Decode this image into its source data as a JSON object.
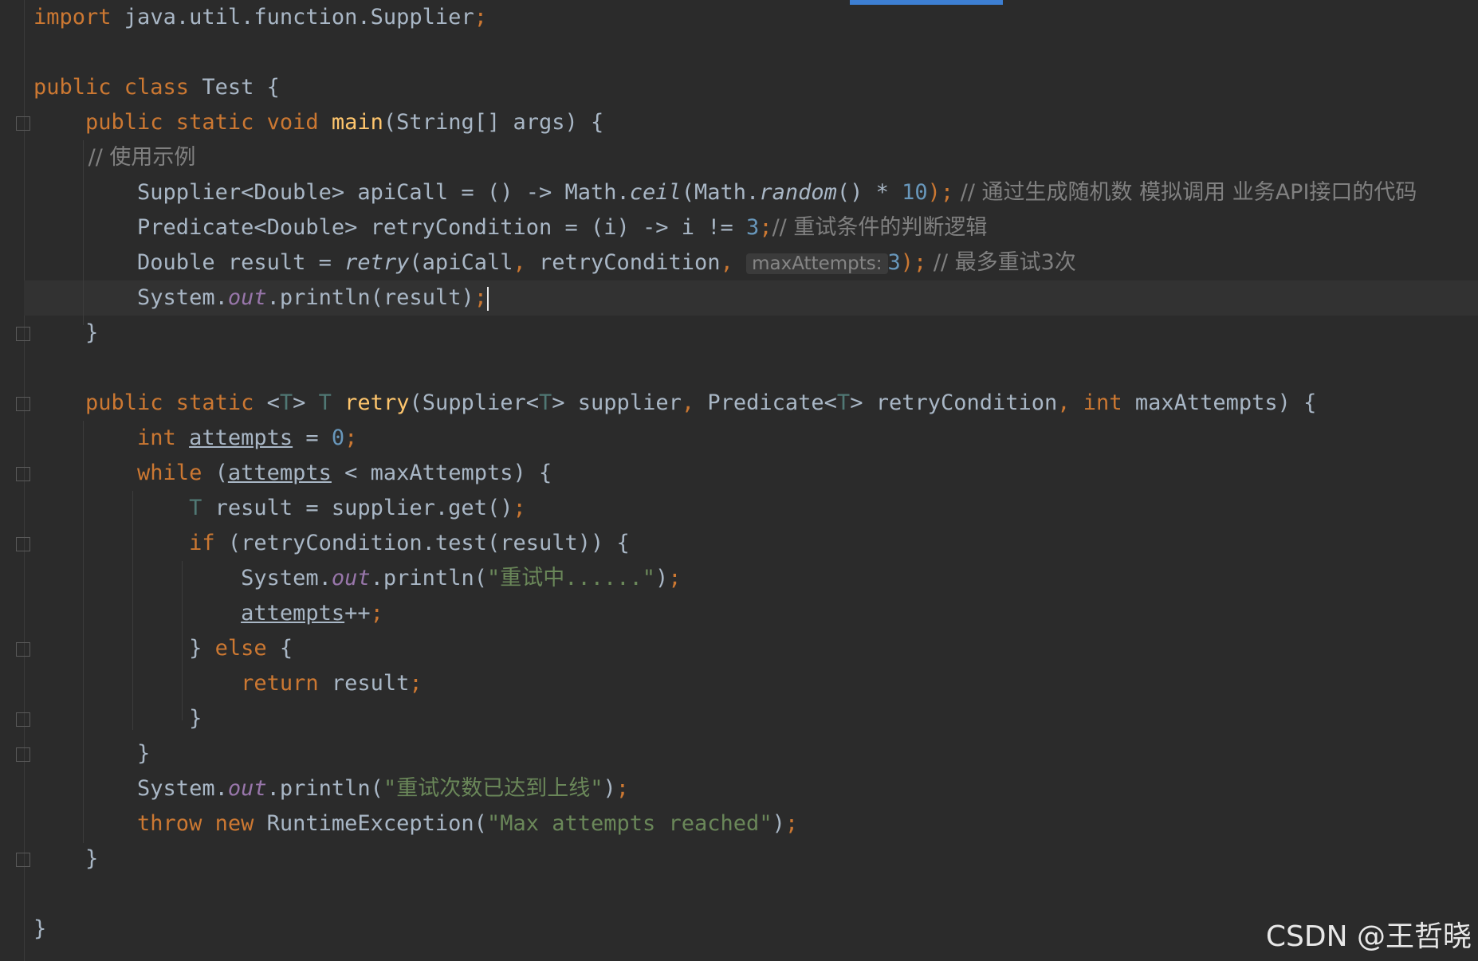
{
  "editor": {
    "line_01_a": "import",
    "line_01_b": " java.util.function.Supplier",
    "line_01_c": ";",
    "line_02_a": "public class",
    "line_02_b": " Test {",
    "line_03_a": "    public static void",
    "line_03_b": "main",
    "line_03_c": "(String[] args) {",
    "line_04_a": "        // 使用示例",
    "line_05_a": "        Supplier<Double> apiCall = () -> Math.",
    "line_05_b": "ceil",
    "line_05_c": "(Math.",
    "line_05_d": "random",
    "line_05_e": "() * ",
    "line_05_f": "10",
    "line_05_g": ");",
    "line_05_h": " // 通过生成随机数 模拟调用 业务API接口的代码",
    "line_06_a": "        Predicate<Double> retryCondition = (i) -> i != ",
    "line_06_b": "3",
    "line_06_c": ";",
    "line_06_d": "// 重试条件的判断逻辑",
    "line_07_a": "        Double result = ",
    "line_07_b": "retry",
    "line_07_c": "(apiCall",
    "line_07_d": ",",
    "line_07_e": " retryCondition",
    "line_07_f": ",",
    "line_07_hint": "maxAttempts:",
    "line_07_g": "3",
    "line_07_h": ");",
    "line_07_i": " // 最多重试3次",
    "line_08_a": "        System.",
    "line_08_b": "out",
    "line_08_c": ".println(result)",
    "line_08_d": ";",
    "line_09_a": "    }",
    "line_10_a": "    public static",
    "line_10_b": " <",
    "line_10_c": "T",
    "line_10_d": "> ",
    "line_10_e": "T",
    "line_10_f": "retry",
    "line_10_g": "(Supplier<",
    "line_10_h": "T",
    "line_10_i": "> supplier",
    "line_10_j": ",",
    "line_10_k": " Predicate<",
    "line_10_l": "T",
    "line_10_m": "> retryCondition",
    "line_10_n": ",",
    "line_10_o": " int",
    "line_10_p": " maxAttempts) {",
    "line_11_a": "        int",
    "line_11_b": "attempts",
    "line_11_c": " = ",
    "line_11_d": "0",
    "line_11_e": ";",
    "line_12_a": "        while",
    "line_12_b": " (",
    "line_12_c": "attempts",
    "line_12_d": " < maxAttempts) {",
    "line_13_a": "            T",
    "line_13_b": " result = supplier.get()",
    "line_13_c": ";",
    "line_14_a": "            if",
    "line_14_b": " (retryCondition.test(result)) {",
    "line_15_a": "                System.",
    "line_15_b": "out",
    "line_15_c": ".println(",
    "line_15_d": "\"重试中......\"",
    "line_15_e": ")",
    "line_15_f": ";",
    "line_16_a": "attempts",
    "line_16_b": "++",
    "line_16_c": ";",
    "line_17_a": "            } ",
    "line_17_b": "else",
    "line_17_c": " {",
    "line_18_a": "                return",
    "line_18_b": " result",
    "line_18_c": ";",
    "line_19_a": "            }",
    "line_20_a": "        }",
    "line_21_a": "        System.",
    "line_21_b": "out",
    "line_21_c": ".println(",
    "line_21_d": "\"重试次数已达到上线\"",
    "line_21_e": ")",
    "line_21_f": ";",
    "line_22_a": "        throw new",
    "line_22_b": " RuntimeException(",
    "line_22_c": "\"Max attempts reached\"",
    "line_22_d": ")",
    "line_22_e": ";",
    "line_23_a": "    }",
    "line_24_a": "}"
  },
  "watermark": "CSDN @王哲晓",
  "colors": {
    "background": "#2b2b2b",
    "keyword": "#cc7832",
    "function": "#ffc66d",
    "number": "#6897bb",
    "string": "#6a8759",
    "comment": "#808080",
    "field": "#9876aa",
    "text": "#a9b7c6",
    "tab_indicator": "#3d7fd3"
  }
}
